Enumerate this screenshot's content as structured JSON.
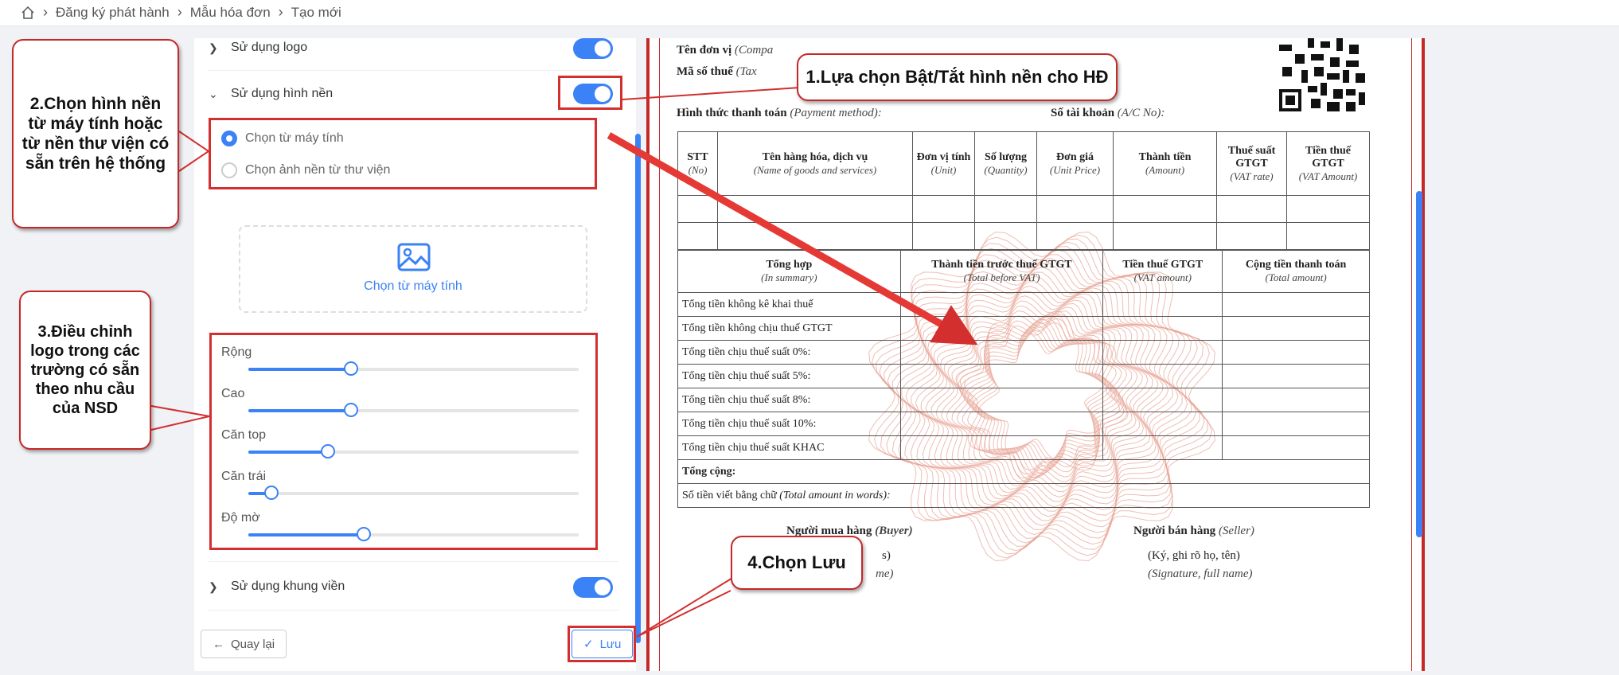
{
  "breadcrumb": {
    "home_icon": "home-icon",
    "items": [
      "Đăng ký phát hành",
      "Mẫu hóa đơn",
      "Tạo mới"
    ]
  },
  "left": {
    "use_logo": "Sử dụng logo",
    "use_background": "Sử dụng hình nền",
    "radio_computer": "Chọn từ máy tính",
    "radio_library": "Chọn ảnh nền từ thư viện",
    "upload_label": "Chọn từ máy tính",
    "sliders": [
      {
        "label": "Rộng",
        "value": 0.31
      },
      {
        "label": "Cao",
        "value": 0.31
      },
      {
        "label": "Căn top",
        "value": 0.24
      },
      {
        "label": "Căn trái",
        "value": 0.07
      },
      {
        "label": "Độ mờ",
        "value": 0.35
      }
    ],
    "use_border": "Sử dụng khung viền",
    "back": "Quay lại",
    "save": "Lưu"
  },
  "preview": {
    "unit_label": "Tên đơn vị",
    "unit_en": "(Compa",
    "tax_label": "Mã số thuế",
    "tax_en": "(Tax",
    "payment_label": "Hình thức thanh toán",
    "payment_en": "(Payment method):",
    "account_label": "Số tài khoản",
    "account_en": "(A/C No):",
    "columns": [
      {
        "vi": "STT",
        "en": "(No)"
      },
      {
        "vi": "Tên hàng hóa, dịch vụ",
        "en": "(Name of goods and services)"
      },
      {
        "vi": "Đơn vị tính",
        "en": "(Unit)"
      },
      {
        "vi": "Số lượng",
        "en": "(Quantity)"
      },
      {
        "vi": "Đơn giá",
        "en": "(Unit Price)"
      },
      {
        "vi": "Thành tiền",
        "en": "(Amount)"
      },
      {
        "vi": "Thuế suất GTGT",
        "en": "(VAT rate)"
      },
      {
        "vi": "Tiền thuế GTGT",
        "en": "(VAT Amount)"
      }
    ],
    "summary_headers": [
      {
        "vi": "Tổng hợp",
        "en": "(In summary)"
      },
      {
        "vi": "Thành tiền trước thuế GTGT",
        "en": "(Total before VAT)"
      },
      {
        "vi": "Tiền thuế GTGT",
        "en": "(VAT amount)"
      },
      {
        "vi": "Cộng tiền thanh toán",
        "en": "(Total amount)"
      }
    ],
    "summary_rows": [
      "Tổng tiền không kê khai thuế",
      "Tổng tiền không chịu thuế GTGT",
      "Tổng tiền chịu thuế suất 0%:",
      "Tổng tiền chịu thuế suất 5%:",
      "Tổng tiền chịu thuế suất 8%:",
      "Tổng tiền chịu thuế suất 10%:",
      "Tổng tiền chịu thuế suất KHAC"
    ],
    "total_row": "Tổng cộng:",
    "words_label": "Số tiền viết bằng chữ",
    "words_en": "(Total amount in words):",
    "buyer": "Người mua hàng",
    "buyer_en": "(Buyer)",
    "seller": "Người bán hàng",
    "seller_en": "(Seller)",
    "sign_left_1": "s)",
    "sign_left_2": "me)",
    "sign_right_1": "(Ký, ghi rõ họ, tên)",
    "sign_right_2": "(Signature, full name)"
  },
  "callouts": {
    "c1": "1.Lựa chọn Bật/Tắt hình nền cho HĐ",
    "c2": "2.Chọn hình nền từ máy tính hoặc từ nền thư viện có sẵn trên hệ thống",
    "c3": "3.Điều chỉnh logo trong các trường có sẵn theo nhu cầu của NSD",
    "c4": "4.Chọn Lưu"
  },
  "colors": {
    "accent": "#3b82f6",
    "annotation": "#d32f2f",
    "watermark": "#e8a89a"
  }
}
